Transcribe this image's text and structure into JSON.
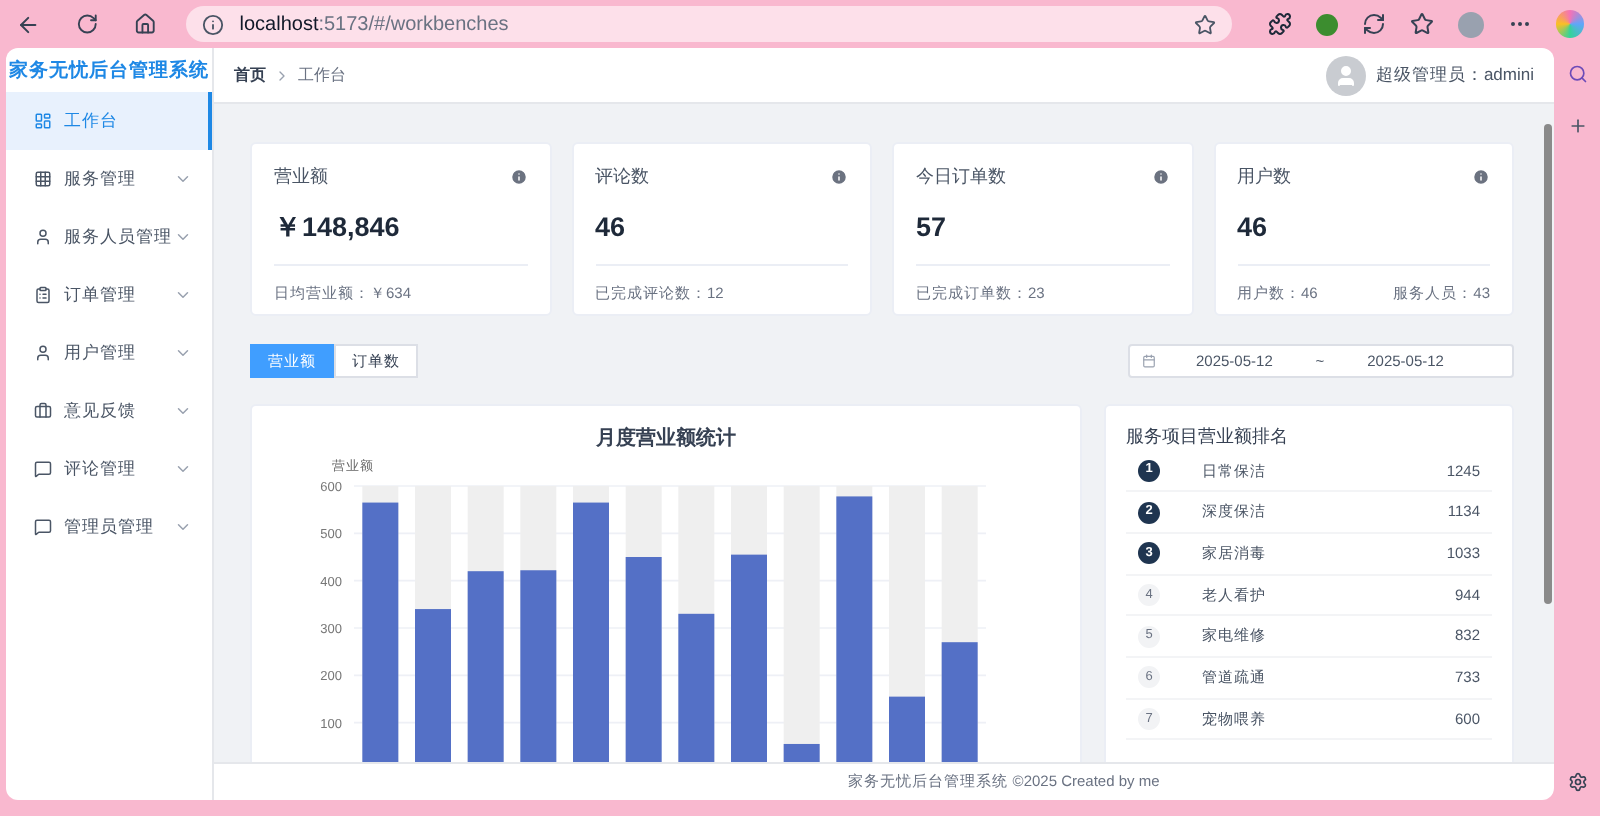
{
  "browser": {
    "url_host": "localhost",
    "url_path": ":5173/#/workbenches"
  },
  "sidebar": {
    "title": "家务无忧后台管理系统",
    "items": [
      {
        "label": "工作台",
        "selected": true,
        "expandable": false
      },
      {
        "label": "服务管理",
        "selected": false,
        "expandable": true
      },
      {
        "label": "服务人员管理",
        "selected": false,
        "expandable": true
      },
      {
        "label": "订单管理",
        "selected": false,
        "expandable": true
      },
      {
        "label": "用户管理",
        "selected": false,
        "expandable": true
      },
      {
        "label": "意见反馈",
        "selected": false,
        "expandable": true
      },
      {
        "label": "评论管理",
        "selected": false,
        "expandable": true
      },
      {
        "label": "管理员管理",
        "selected": false,
        "expandable": true
      }
    ]
  },
  "header": {
    "breadcrumb": [
      "首页",
      "工作台"
    ],
    "user": "超级管理员：admini"
  },
  "stats": [
    {
      "title": "营业额",
      "value": "￥148,846",
      "footer": [
        "日均营业额：￥634"
      ]
    },
    {
      "title": "评论数",
      "value": "46",
      "footer": [
        "已完成评论数：12"
      ]
    },
    {
      "title": "今日订单数",
      "value": "57",
      "footer": [
        "已完成订单数：23"
      ]
    },
    {
      "title": "用户数",
      "value": "46",
      "footer": [
        "用户数：46",
        "服务人员：43"
      ]
    }
  ],
  "tabs": [
    {
      "label": "营业额",
      "selected": true
    },
    {
      "label": "订单数",
      "selected": false
    }
  ],
  "date_range": {
    "start": "2025-05-12",
    "separator": "~",
    "end": "2025-05-12"
  },
  "chart": {
    "chart_data": {
      "type": "bar",
      "grid": true,
      "title": "月度营业额统计",
      "ylabel": "营业额",
      "ylim": [
        0,
        600
      ],
      "yticks": [
        100,
        200,
        300,
        400,
        500,
        600
      ],
      "values": [
        565,
        340,
        420,
        422,
        565,
        450,
        330,
        455,
        55,
        578,
        155,
        270
      ]
    }
  },
  "ranking": {
    "title": "服务项目营业额排名",
    "items": [
      {
        "rank": "1",
        "name": "日常保洁",
        "value": "1245",
        "highlight": true
      },
      {
        "rank": "2",
        "name": "深度保洁",
        "value": "1134",
        "highlight": true
      },
      {
        "rank": "3",
        "name": "家居消毒",
        "value": "1033",
        "highlight": true
      },
      {
        "rank": "4",
        "name": "老人看护",
        "value": "944",
        "highlight": false
      },
      {
        "rank": "5",
        "name": "家电维修",
        "value": "832",
        "highlight": false
      },
      {
        "rank": "6",
        "name": "管道疏通",
        "value": "733",
        "highlight": false
      },
      {
        "rank": "7",
        "name": "宠物喂养",
        "value": "600",
        "highlight": false
      }
    ]
  },
  "footer": "家务无忧后台管理系统 ©2025 Created by me"
}
